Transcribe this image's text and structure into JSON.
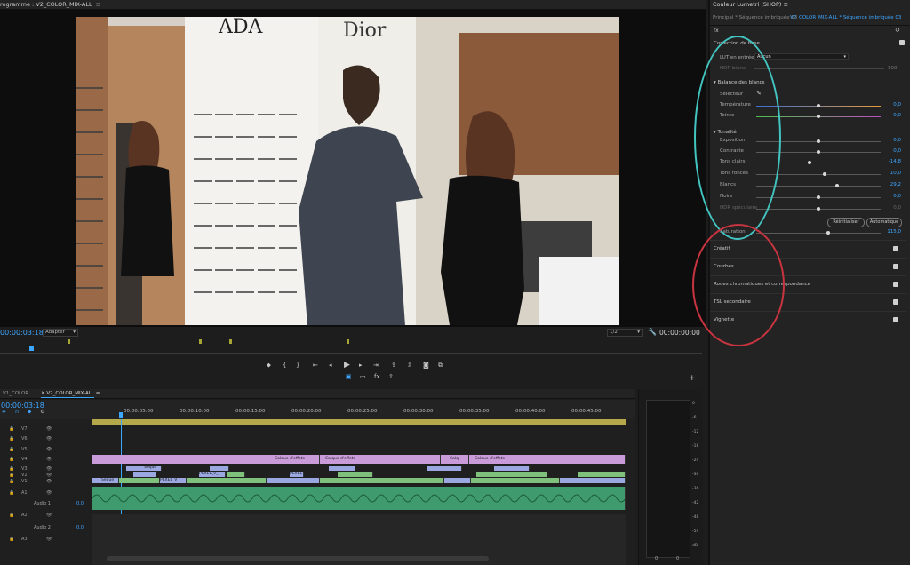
{
  "program_monitor": {
    "title": "rogramme : V2_COLOR_MIX-ALL",
    "menu_icon": "hamburger-icon",
    "timecode_current": "00:00:03:18",
    "fit": "Adapter",
    "resolution": "1/2",
    "timecode_duration": "00:00:00:00"
  },
  "lumetri": {
    "title": "Couleur Lumetri (SHOP)",
    "tab_main": "Principal * Séquence imbriquée 03",
    "tab_sequence": "V2_COLOR_MIX-ALL * Séquence imbriquée 03",
    "fx_label": "fx",
    "basic_correction": "Correction de base",
    "lut_label": "LUT en entrée",
    "lut_value": "Aucun",
    "hdr_white_label": "HDR blanc",
    "hdr_white_value": "100",
    "white_balance": "Balance des blancs",
    "selector_label": "Sélecteur",
    "tone": "Tonalité",
    "sliders": [
      {
        "label": "Température",
        "value": "0,0",
        "pos": 0.5
      },
      {
        "label": "Teinte",
        "value": "0,0",
        "pos": 0.5
      },
      {
        "label": "Exposition",
        "value": "0,0",
        "pos": 0.5
      },
      {
        "label": "Contraste",
        "value": "0,0",
        "pos": 0.5
      },
      {
        "label": "Tons clairs",
        "value": "-14,8",
        "pos": 0.43
      },
      {
        "label": "Tons foncés",
        "value": "10,0",
        "pos": 0.55
      },
      {
        "label": "Blancs",
        "value": "29,2",
        "pos": 0.65
      },
      {
        "label": "Noirs",
        "value": "0,0",
        "pos": 0.5
      },
      {
        "label": "HDR spéculaire",
        "value": "0,0",
        "pos": 0.5
      }
    ],
    "reset_button": "Réinitialiser",
    "auto_button": "Automatique",
    "saturation_label": "Saturation",
    "saturation_value": "115,0",
    "saturation_pos": 0.575,
    "sections": [
      "Créatif",
      "Courbes",
      "Roues chromatiques et correspondance",
      "TSL secondaire",
      "Vignette"
    ]
  },
  "timeline": {
    "tab1": "V1_COLOR",
    "tab2": "V2_COLOR_MIX-ALL",
    "timecode": "00:00:03:18",
    "ticks": [
      "00:00:05:00",
      "00:00:10:00",
      "00:00:15:00",
      "00:00:20:00",
      "00:00:25:00",
      "00:00:30:00",
      "00:00:35:00",
      "00:00:40:00",
      "00:00:45:00"
    ],
    "tracks": [
      "V7",
      "V6",
      "V5",
      "V4",
      "V3",
      "V2",
      "V1",
      "A1",
      "A2",
      "A3"
    ],
    "audio1_name": "Audio 1",
    "audio1_value": "0,0",
    "audio2_name": "Audio 2",
    "audio2_value": "0,0",
    "clip_labels": [
      "Calque d'effets",
      "Calque d'effets",
      "Calq",
      "Calque d'effets",
      "Séque",
      "PEXEL_V_",
      "PEXEL_V_",
      "PEXEL",
      "Séque"
    ]
  },
  "meter": {
    "scale": [
      "0",
      "-6",
      "-12",
      "-18",
      "-24",
      "-30",
      "-36",
      "-42",
      "-48",
      "-54",
      "dB"
    ],
    "left": "0",
    "right": "0"
  }
}
